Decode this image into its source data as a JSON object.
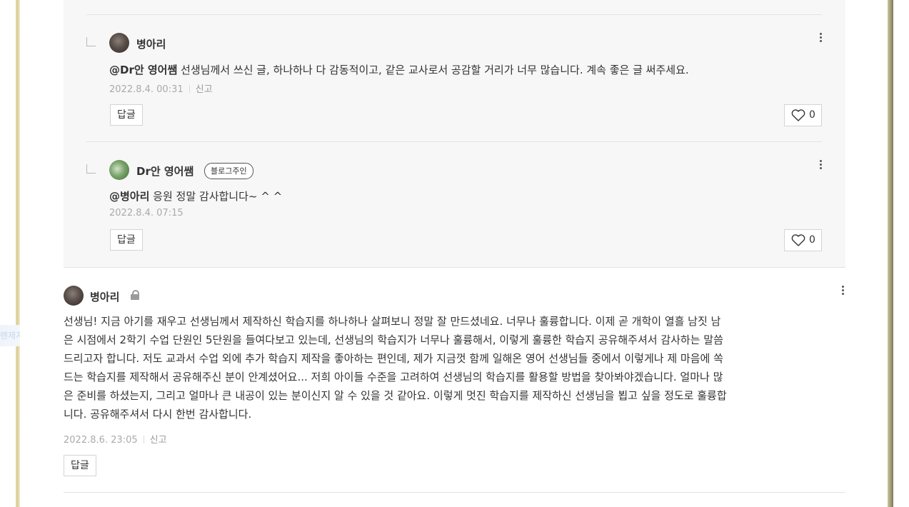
{
  "side_ghost": "렌제지",
  "replies": [
    {
      "nickname": "병아리",
      "mention": "@Dr안 영어쌤",
      "text": " 선생님께서 쓰신 글, 하나하나 다 감동적이고, 같은 교사로서 공감할 거리가 너무 많습니다. 계속 좋은 글 써주세요.",
      "date": "2022.8.4. 00:31",
      "report_label": "신고",
      "reply_label": "답글",
      "likes": "0"
    },
    {
      "nickname": "Dr안 영어쌤",
      "badge": "블로그주인",
      "mention": "@병아리",
      "text": " 응원 정말 감사합니다~ ^ ^",
      "date": "2022.8.4. 07:15",
      "reply_label": "답글",
      "likes": "0"
    }
  ],
  "comment": {
    "nickname": "병아리",
    "lines": [
      "선생님! 지금 아기를 재우고 선생님께서 제작하신 학습지를 하나하나 살펴보니 정말 잘 만드셨네요. 너무나 훌륭합니다. 이제 곧 개학이 열흘 남짓 남",
      "은 시점에서 2학기 수업 단원인 5단원을 들여다보고 있는데, 선생님의 학습지가 너무나 훌륭해서, 이렇게 훌륭한 학습지 공유해주셔서 감사하는 말씀",
      "드리고자 합니다. 저도 교과서 수업 외에 추가 학습지 제작을 좋아하는 편인데, 제가 지금껏 함께 일해온 영어 선생님들 중에서 이렇게나 제 마음에 쏙",
      "드는 학습지를 제작해서 공유해주신 분이 안계셨어요... 저희 아이들 수준을 고려하여 선생님의 학습지를 활용할 방법을 찾아봐야겠습니다. 얼마나 많",
      "은 준비를 하셨는지, 그리고 얼마나 큰 내공이 있는 분이신지 알 수 있을 것 같아요. 이렇게 멋진 학습지를 제작하신 선생님을 뵙고 싶을 정도로 훌륭합",
      "니다. 공유해주셔서 다시 한번 감사합니다."
    ],
    "date": "2022.8.6. 23:05",
    "report_label": "신고",
    "reply_label": "답글"
  },
  "colors": {
    "reply_bg": "#f7f7f7",
    "frame_left": "#e0d6a6",
    "frame_right": "#9a9478"
  },
  "icons": {
    "heart": "heart-outline-icon",
    "lock": "lock-icon",
    "more": "more-vertical-icon"
  }
}
